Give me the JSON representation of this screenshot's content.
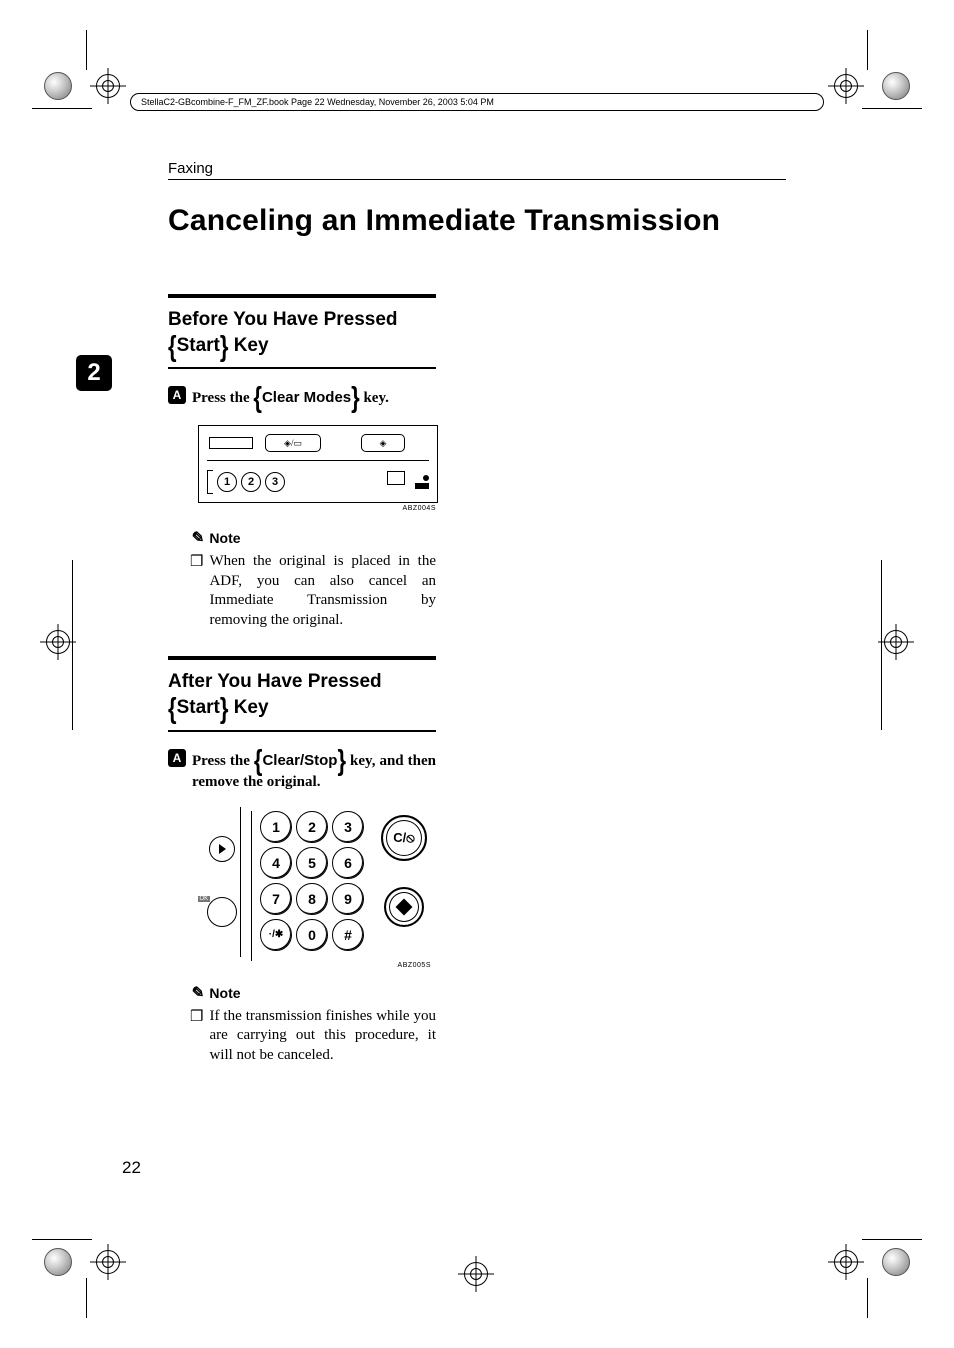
{
  "crop_header": "StellaC2-GBcombine-F_FM_ZF.book  Page 22  Wednesday, November 26, 2003  5:04 PM",
  "section_label": "Faxing",
  "h1": "Canceling an Immediate Transmission",
  "chapter_num": "2",
  "before": {
    "heading_line1": "Before You Have Pressed",
    "heading_key": "Start",
    "heading_line2_suffix": " Key",
    "step1_num": "A",
    "step1_prefix": "Press the ",
    "step1_key": "Clear Modes",
    "step1_suffix": " key.",
    "fig_caption": "ABZ004S",
    "note_label": "Note",
    "note_text": "When the original is placed in the ADF, you can also cancel an Immediate Transmission by removing the original."
  },
  "after": {
    "heading_line1": "After You Have Pressed",
    "heading_key": "Start",
    "heading_line2_suffix": " Key",
    "step1_num": "A",
    "step1_prefix": "Press the ",
    "step1_key": "Clear/Stop",
    "step1_suffix": " key, and then remove the original.",
    "fig_caption": "ABZ005S",
    "note_label": "Note",
    "note_text": "If the transmission finishes while you are carrying out this procedure, it will not be canceled."
  },
  "keypad": {
    "ok": "OK",
    "keys": [
      "1",
      "2",
      "3",
      "4",
      "5",
      "6",
      "7",
      "8",
      "9",
      "·/✱",
      "0",
      "#"
    ],
    "clear_stop": "C/",
    "quick_keys": [
      "1",
      "2",
      "3"
    ]
  },
  "page_number": "22"
}
